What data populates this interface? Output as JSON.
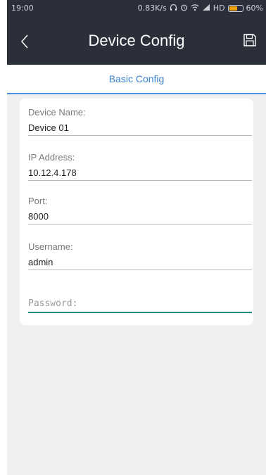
{
  "status_bar": {
    "time": "19:00",
    "network_speed": "0.83K/s",
    "network_type": "HD",
    "battery": "60%",
    "battery_fraction": 0.6,
    "icons": [
      "headset-icon",
      "alarm-icon",
      "wifi-icon",
      "signal-icon",
      "battery-icon"
    ]
  },
  "header": {
    "title": "Device Config",
    "back_icon": "chevron-left-icon",
    "save_icon": "save-icon"
  },
  "tabs": [
    {
      "label": "Basic Config",
      "active": true
    }
  ],
  "form": {
    "device_name": {
      "label": "Device Name:",
      "value": "Device 01"
    },
    "ip_address": {
      "label": "IP Address:",
      "value": "10.12.4.178"
    },
    "port": {
      "label": "Port:",
      "value": "8000"
    },
    "username": {
      "label": "Username:",
      "value": "admin"
    },
    "password": {
      "placeholder": "Password:",
      "value": ""
    }
  },
  "colors": {
    "header_bg": "#2b2f3a",
    "tab_accent": "#3b82d2",
    "focus_line": "#1e8e7e",
    "battery_fill": "#f1a10d",
    "page_bg": "#f0f0f0"
  }
}
